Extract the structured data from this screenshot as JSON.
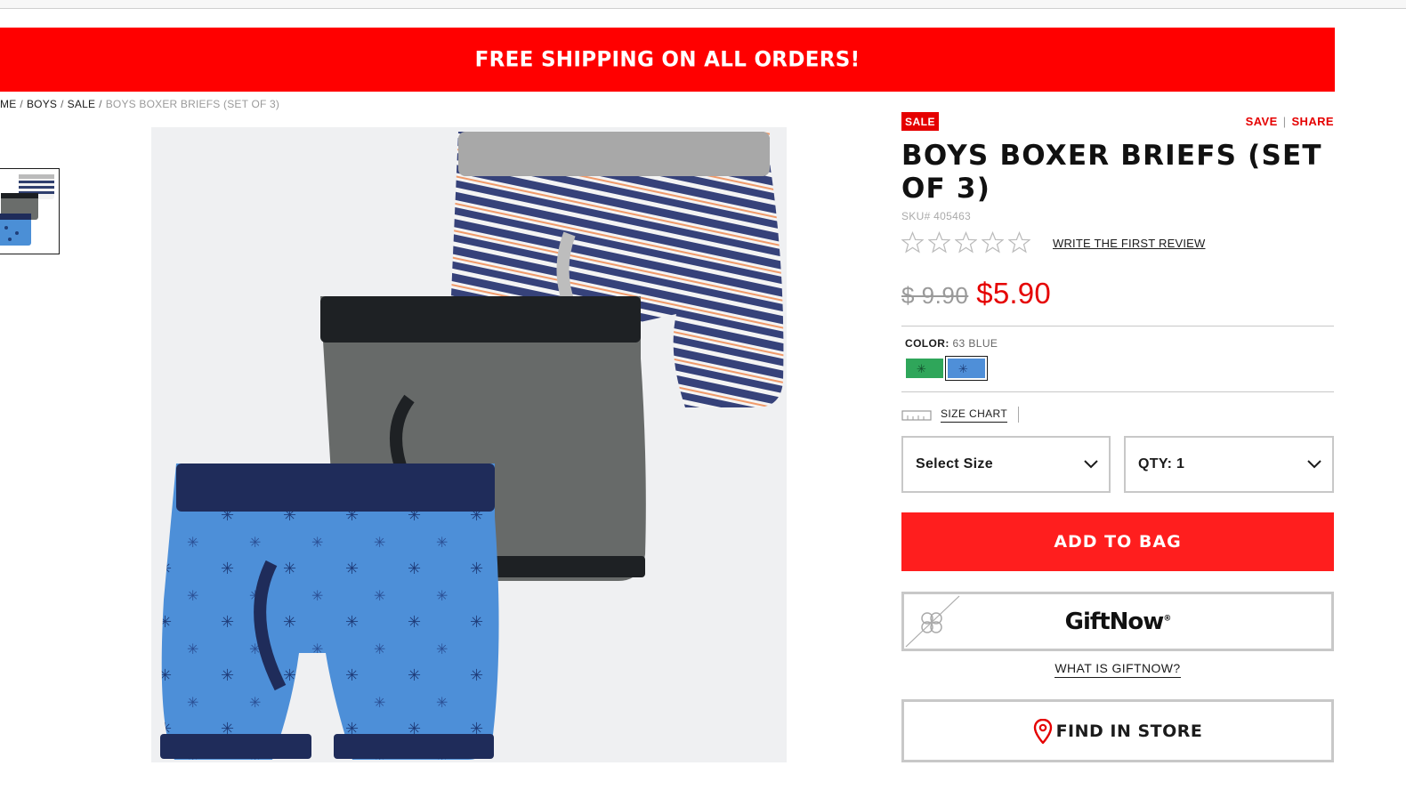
{
  "promo": {
    "text": "FREE SHIPPING ON ALL ORDERS!"
  },
  "breadcrumb": {
    "items": [
      "ME",
      "BOYS",
      "SALE"
    ],
    "current": "BOYS BOXER BRIEFS (SET OF 3)"
  },
  "product": {
    "badge": "SALE",
    "save_label": "SAVE",
    "share_label": "SHARE",
    "title": "BOYS BOXER BRIEFS (SET OF 3)",
    "sku": "SKU# 405463",
    "rating": 0,
    "rating_max": 5,
    "review_link": "WRITE THE FIRST REVIEW",
    "price_old": "$ 9.90",
    "price_new": "$5.90",
    "color_label": "COLOR:",
    "color_value": "63 BLUE",
    "swatches": [
      {
        "name": "green",
        "color": "#2fa65a",
        "selected": false
      },
      {
        "name": "blue",
        "color": "#4f8fd8",
        "selected": true
      }
    ],
    "size_chart_label": "SIZE CHART",
    "size_select": "Select Size",
    "qty_select": "QTY: 1",
    "add_to_bag": "ADD TO BAG",
    "giftnow_brand": "GiftNow",
    "giftnow_reg": "®",
    "what_giftnow": "WHAT IS GIFTNOW?",
    "find_in_store": "FIND IN STORE"
  },
  "colors": {
    "brand_red": "#ff0000",
    "button_red": "#ff1e1e",
    "sale_text_red": "#e50000",
    "image_bg": "#eff0f2"
  }
}
